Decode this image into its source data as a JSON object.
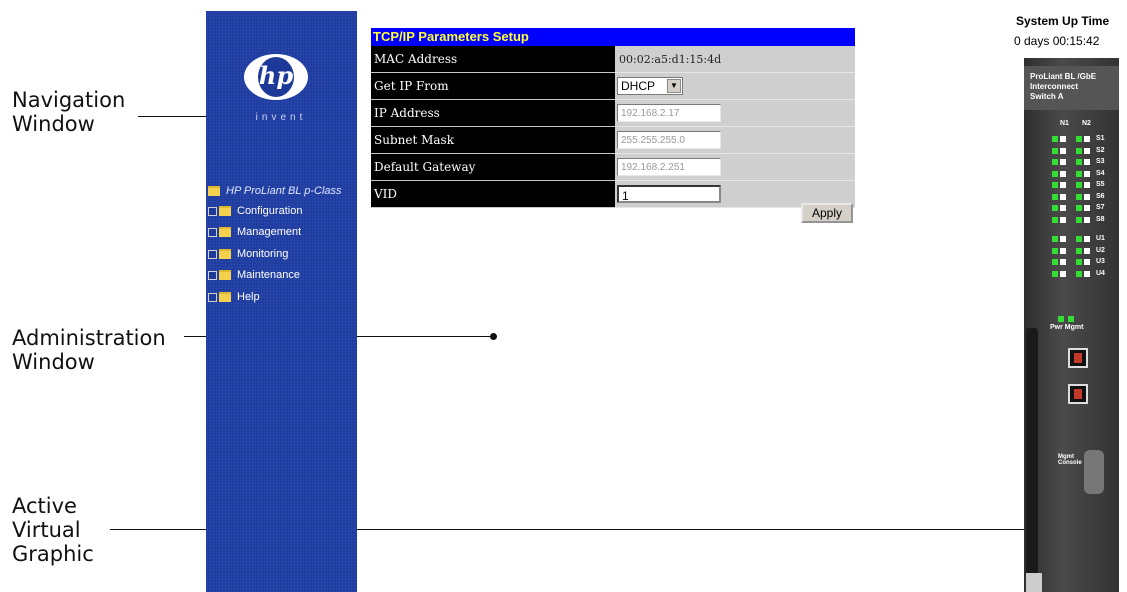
{
  "callouts": {
    "navigation": [
      "Navigation",
      "Window"
    ],
    "administration": [
      "Administration",
      "Window"
    ],
    "active_graphic": [
      "Active",
      "Virtual",
      "Graphic"
    ]
  },
  "nav": {
    "logo_text": "hp",
    "logo_tagline": "invent",
    "root": "HP ProLiant BL p-Class",
    "items": [
      "Configuration",
      "Management",
      "Monitoring",
      "Maintenance",
      "Help"
    ]
  },
  "form": {
    "title": "TCP/IP Parameters Setup",
    "rows": [
      {
        "label": "MAC Address",
        "value": "00:02:a5:d1:15:4d"
      },
      {
        "label": "Get IP From",
        "value": "DHCP"
      },
      {
        "label": "IP Address",
        "value": "192.168.2.17"
      },
      {
        "label": "Subnet Mask",
        "value": "255.255.255.0"
      },
      {
        "label": "Default Gateway",
        "value": "192.168.2.251"
      },
      {
        "label": "VID",
        "value": "1"
      }
    ],
    "apply_label": "Apply"
  },
  "device": {
    "uptime_title": "System Up Time",
    "uptime_value": "0 days 00:15:42",
    "head_lines": [
      "ProLiant BL /GbE",
      "Interconnect",
      "Switch A"
    ],
    "col_labels": [
      "N1",
      "N2"
    ],
    "port_labels": [
      "S1",
      "S2",
      "S3",
      "S4",
      "S5",
      "S6",
      "S7",
      "S8"
    ],
    "uplink_labels": [
      "U1",
      "U2",
      "U3",
      "U4"
    ],
    "pwr_label": "Pwr Mgmt",
    "console_label": "Mgmt Console"
  },
  "colors": {
    "nav_bg": "#1d3a9a",
    "title_bar": "#0000ff",
    "title_text": "#ffff33",
    "led_green": "#33dd33"
  }
}
